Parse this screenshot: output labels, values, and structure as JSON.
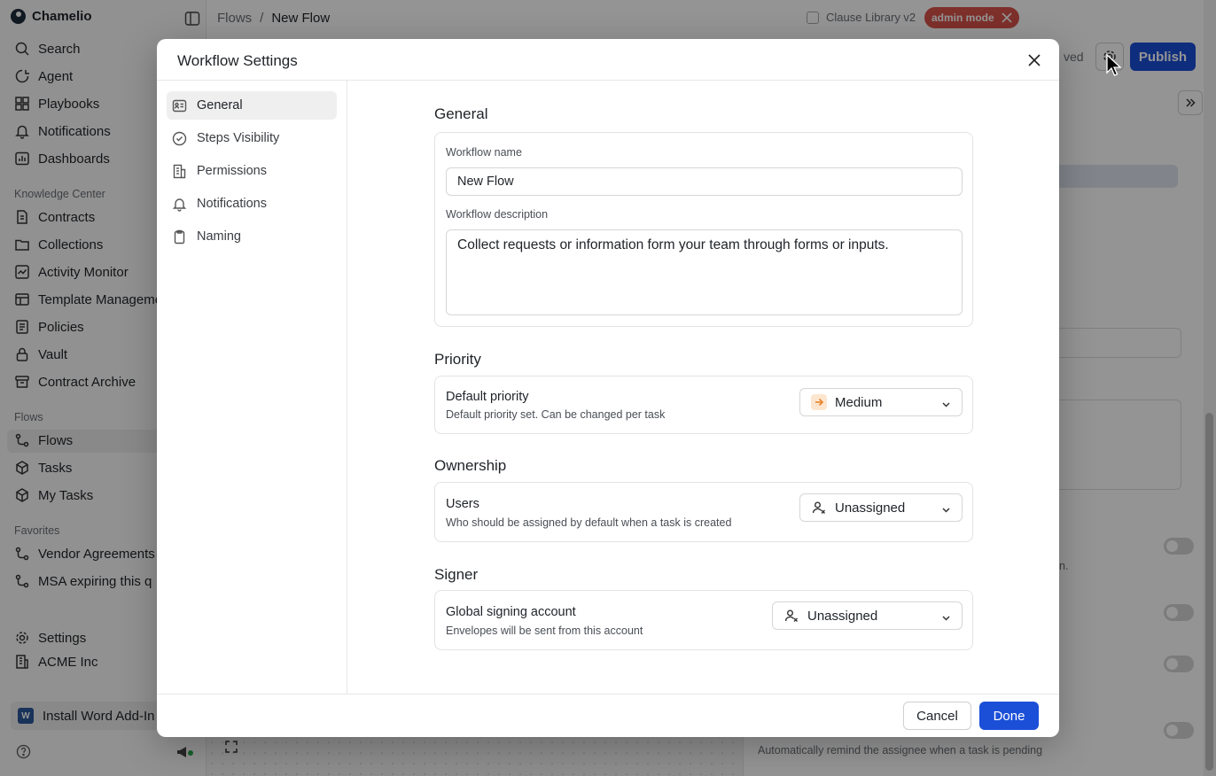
{
  "app": {
    "name": "Chamelio"
  },
  "sidebar": {
    "main": [
      "Search",
      "Agent",
      "Playbooks",
      "Notifications",
      "Dashboards"
    ],
    "knowledge_title": "Knowledge Center",
    "knowledge": [
      "Contracts",
      "Collections",
      "Activity Monitor",
      "Template Management",
      "Policies",
      "Vault",
      "Contract Archive"
    ],
    "flows_title": "Flows",
    "flows": [
      "Flows",
      "Tasks",
      "My Tasks"
    ],
    "favorites_title": "Favorites",
    "favorites": [
      "Vendor Agreements",
      "MSA expiring this q"
    ],
    "bottom": [
      "Settings",
      "ACME Inc"
    ],
    "install_word": "Install Word Add-In",
    "active_item": "Flows"
  },
  "topbar": {
    "breadcrumb": [
      "Flows",
      "New Flow"
    ],
    "breadcrumb_sep": "/",
    "clause_library": "Clause Library v2",
    "admin_badge": "admin mode",
    "saved": "ved",
    "publish": "Publish"
  },
  "background_panel": {
    "remind_text": "Automatically remind the assignee when a task is pending",
    "partial_text": "n."
  },
  "modal": {
    "title": "Workflow Settings",
    "nav": [
      {
        "label": "General",
        "icon": "id-card-icon",
        "active": true
      },
      {
        "label": "Steps Visibility",
        "icon": "check-circle-icon"
      },
      {
        "label": "Permissions",
        "icon": "building-icon"
      },
      {
        "label": "Notifications",
        "icon": "bell-icon"
      },
      {
        "label": "Naming",
        "icon": "clipboard-icon"
      }
    ],
    "general": {
      "title": "General",
      "name_label": "Workflow name",
      "name_value": "New Flow",
      "description_label": "Workflow description",
      "description_value": "Collect requests or information form your team through forms or inputs."
    },
    "priority": {
      "title": "Priority",
      "row_title": "Default priority",
      "row_sub": "Default priority set. Can be changed per task",
      "selected": "Medium",
      "accent": "#e8822c"
    },
    "ownership": {
      "title": "Ownership",
      "row_title": "Users",
      "row_sub": "Who should be assigned by default when a task is created",
      "selected": "Unassigned"
    },
    "signer": {
      "title": "Signer",
      "row_title": "Global signing account",
      "row_sub": "Envelopes will be sent from this account",
      "selected": "Unassigned"
    },
    "footer": {
      "cancel": "Cancel",
      "done": "Done"
    }
  },
  "colors": {
    "primary": "#1b4fd8",
    "admin_badge": "#d9544a"
  }
}
